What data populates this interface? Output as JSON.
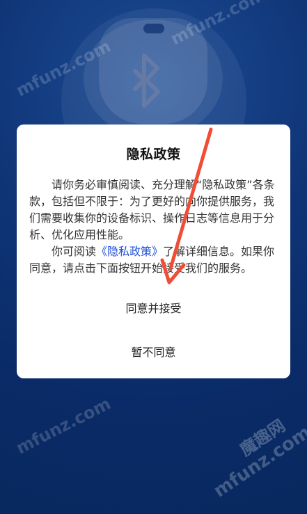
{
  "background": {
    "icon_name": "bluetooth-icon",
    "watermarks": [
      "mfunz.com",
      "mfunz.com",
      "mfunz.com",
      "mfunz.com",
      "魔趣网"
    ],
    "colors": {
      "primary": "#0d2f6e",
      "glow": "#1d4c95",
      "icon": "#667aa6"
    }
  },
  "dialog": {
    "title": "隐私政策",
    "paragraph1": "请你务必审慎阅读、充分理解“隐私政策”各条款，包括但不限于：为了更好的向你提供服务，我们需要收集你的设备标识、操作日志等信息用于分析、优化应用性能。",
    "paragraph2_prefix": "你可阅读",
    "paragraph2_link": "《隐私政策》",
    "paragraph2_suffix": "了解详细信息。如果你同意，请点击下面按钮开始接受我们的服务。",
    "accept_label": "同意并接受",
    "decline_label": "暂不同意",
    "colors": {
      "card": "#ffffff",
      "text": "#333333",
      "title": "#111111",
      "link": "#1f4fd8",
      "annotation": "#ef4d36"
    }
  }
}
